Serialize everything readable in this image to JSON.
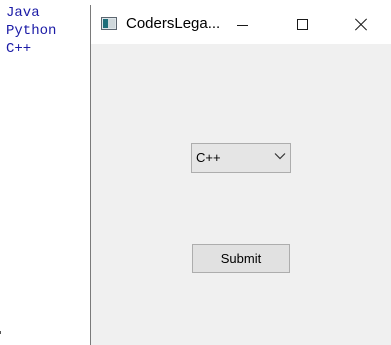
{
  "console": {
    "lines": [
      "Java",
      "Python",
      "C++"
    ]
  },
  "window": {
    "title": "CodersLega...",
    "icon": "tk-window-icon",
    "controls": {
      "minimize_icon": "minimize-icon",
      "maximize_icon": "maximize-icon",
      "close_icon": "close-icon"
    }
  },
  "combobox": {
    "selected": "C++",
    "arrow_icon": "chevron-down-icon"
  },
  "submit": {
    "label": "Submit"
  }
}
